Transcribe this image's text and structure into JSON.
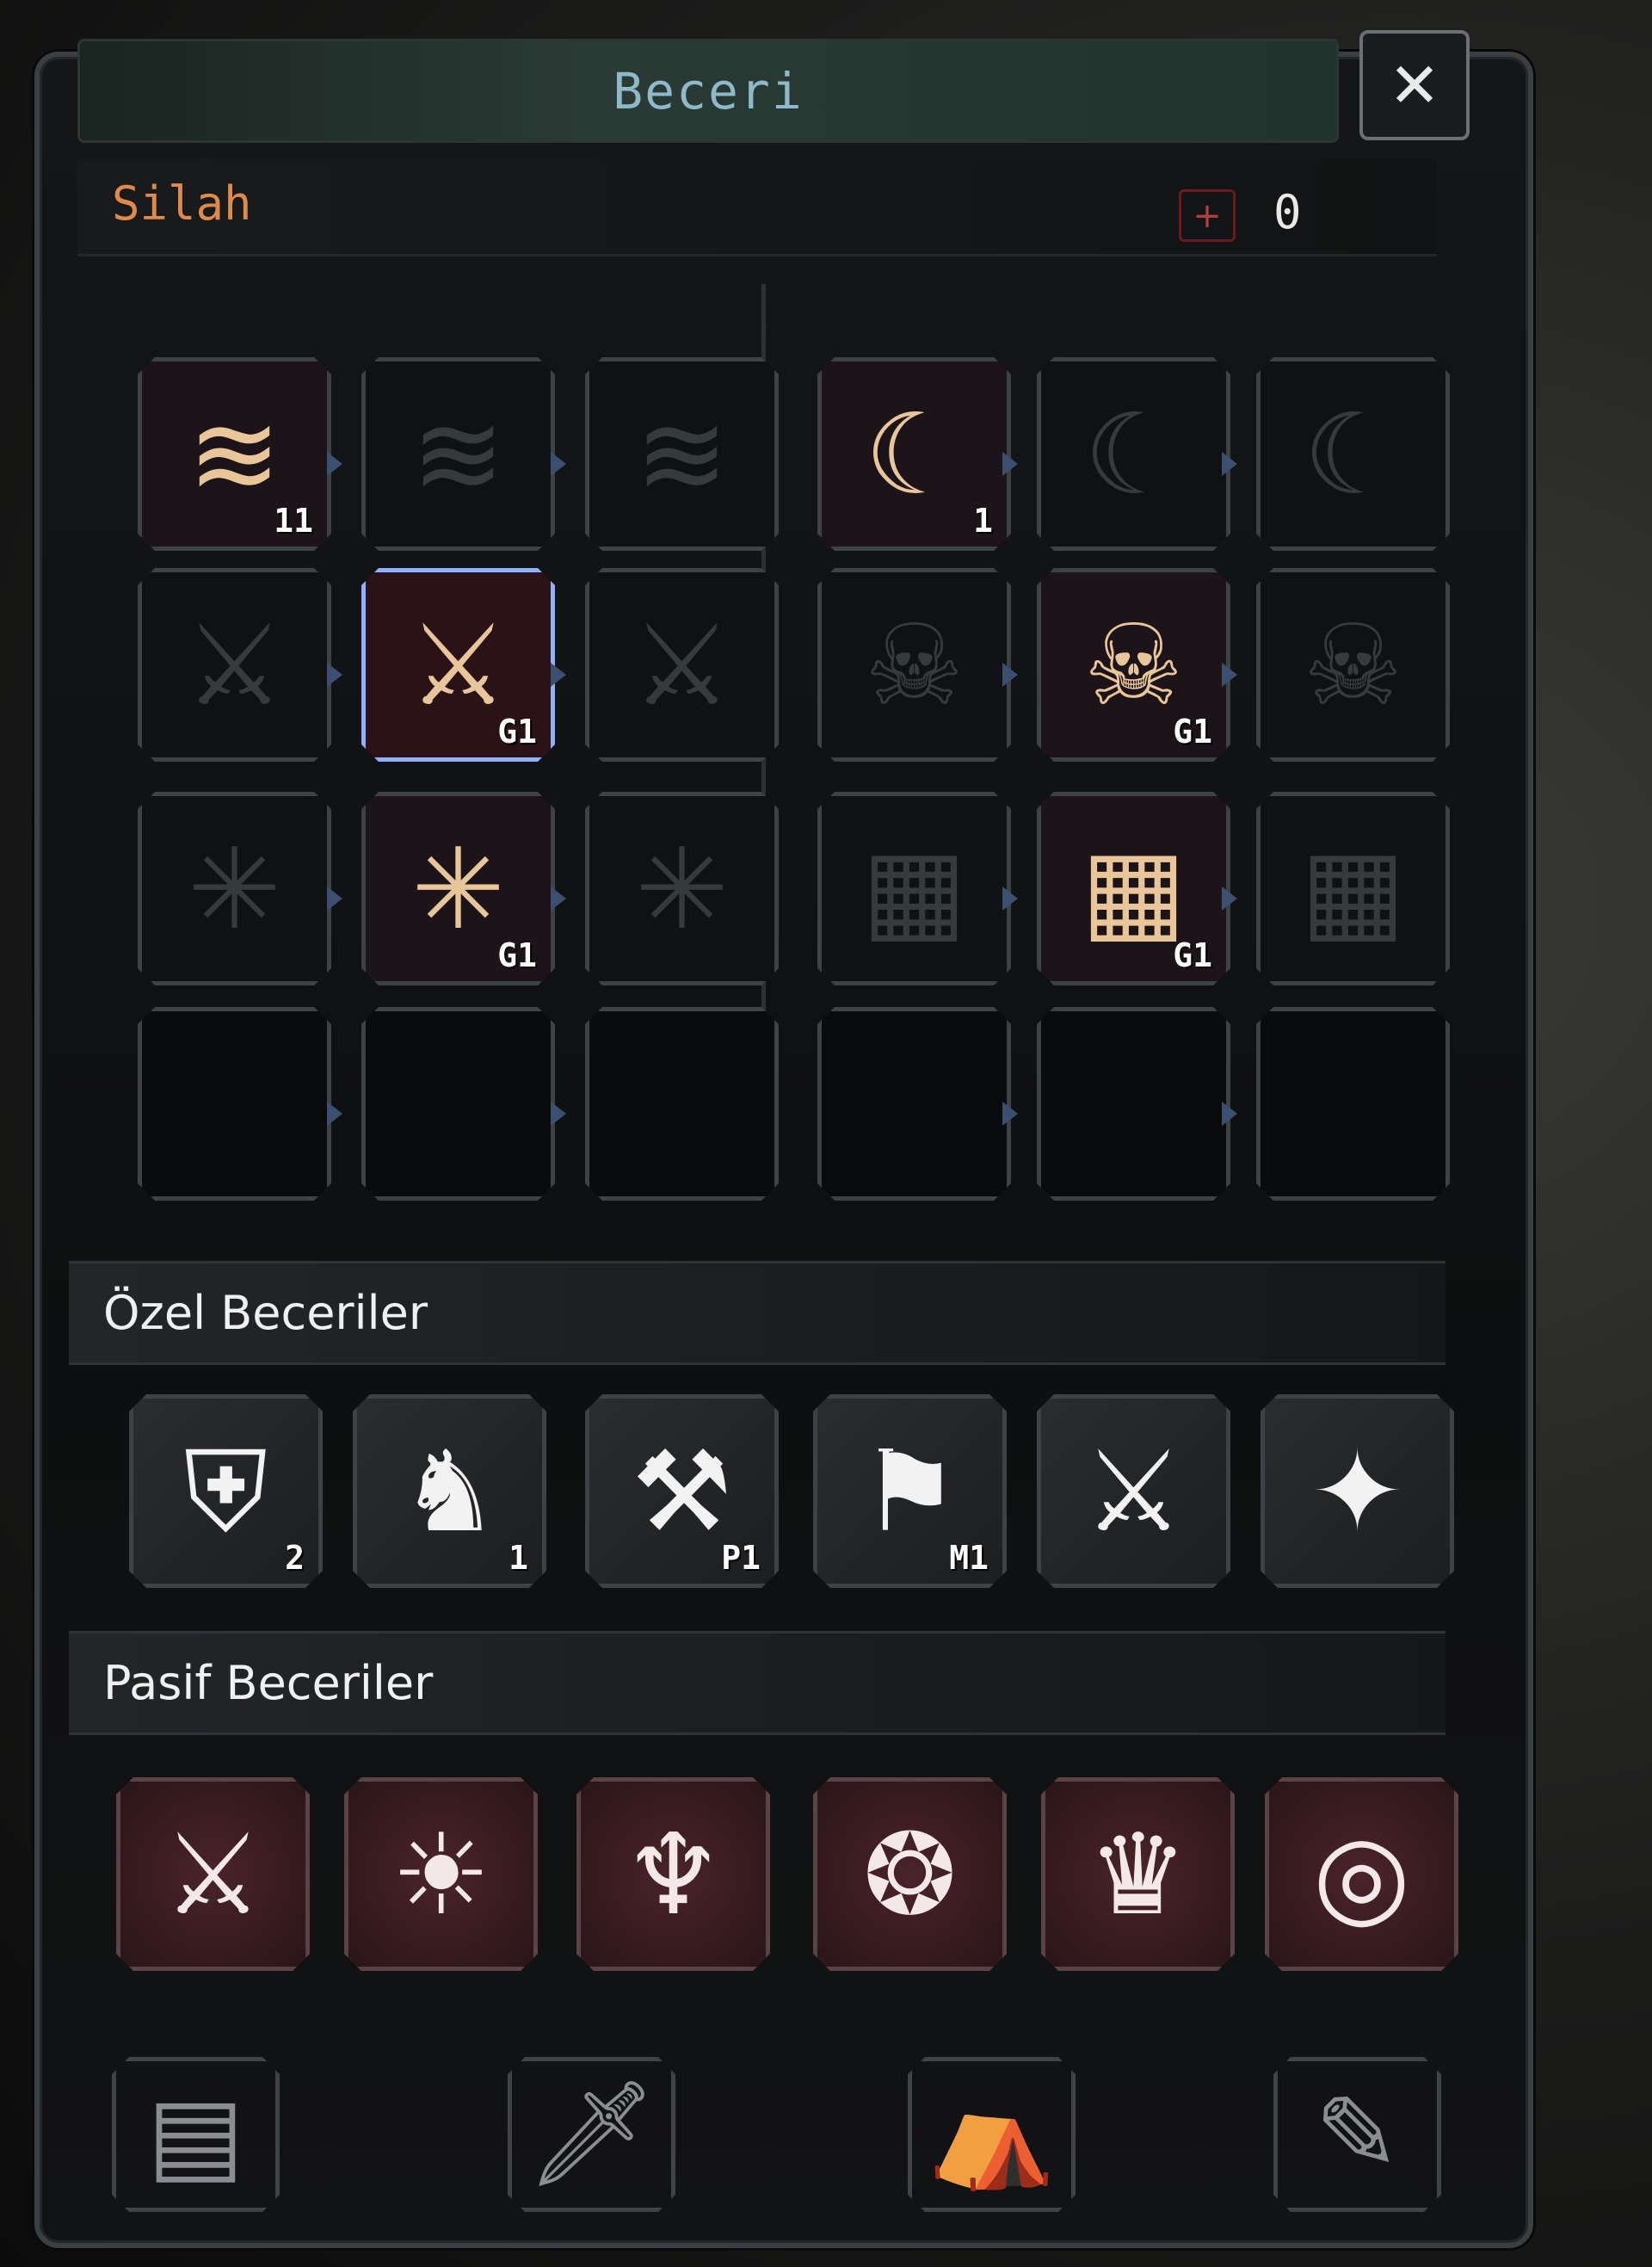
{
  "window": {
    "title": "Beceri",
    "close_label": "✕"
  },
  "weapon": {
    "label": "Silah",
    "points_plus": "+",
    "points": "0"
  },
  "weapon_grid": [
    {
      "icon": "wind-slash-icon",
      "glyph": "≋",
      "state": "lit",
      "level": "11"
    },
    {
      "icon": "wind-slash-icon",
      "glyph": "≋",
      "state": "dim",
      "level": ""
    },
    {
      "icon": "wind-slash-icon",
      "glyph": "≋",
      "state": "dim",
      "level": ""
    },
    {
      "icon": "crescent-blade-icon",
      "glyph": "☾",
      "state": "lit",
      "level": "1"
    },
    {
      "icon": "crescent-blade-icon",
      "glyph": "☾",
      "state": "dim",
      "level": ""
    },
    {
      "icon": "crescent-blade-icon",
      "glyph": "☾",
      "state": "dim",
      "level": ""
    },
    {
      "icon": "sword-icon",
      "glyph": "⚔",
      "state": "dim",
      "level": ""
    },
    {
      "icon": "sword-icon",
      "glyph": "⚔",
      "state": "selected",
      "level": "G1"
    },
    {
      "icon": "sword-icon",
      "glyph": "⚔",
      "state": "dim",
      "level": ""
    },
    {
      "icon": "skull-icon",
      "glyph": "☠",
      "state": "dim",
      "level": ""
    },
    {
      "icon": "skull-icon",
      "glyph": "☠",
      "state": "lit",
      "level": "G1"
    },
    {
      "icon": "skull-icon",
      "glyph": "☠",
      "state": "dim",
      "level": ""
    },
    {
      "icon": "burst-icon",
      "glyph": "✳",
      "state": "dim",
      "level": ""
    },
    {
      "icon": "burst-icon",
      "glyph": "✳",
      "state": "lit",
      "level": "G1"
    },
    {
      "icon": "burst-icon",
      "glyph": "✳",
      "state": "dim",
      "level": ""
    },
    {
      "icon": "rune-icon",
      "glyph": "▦",
      "state": "dim",
      "level": ""
    },
    {
      "icon": "rune-icon",
      "glyph": "▦",
      "state": "lit",
      "level": "G1"
    },
    {
      "icon": "rune-icon",
      "glyph": "▦",
      "state": "dim",
      "level": ""
    },
    {
      "icon": "empty-slot",
      "glyph": "",
      "state": "empty",
      "level": ""
    },
    {
      "icon": "empty-slot",
      "glyph": "",
      "state": "empty",
      "level": ""
    },
    {
      "icon": "empty-slot",
      "glyph": "",
      "state": "empty",
      "level": ""
    },
    {
      "icon": "empty-slot",
      "glyph": "",
      "state": "empty",
      "level": ""
    },
    {
      "icon": "empty-slot",
      "glyph": "",
      "state": "empty",
      "level": ""
    },
    {
      "icon": "empty-slot",
      "glyph": "",
      "state": "empty",
      "level": ""
    }
  ],
  "special": {
    "label": "Özel Beceriler",
    "items": [
      {
        "icon": "sword-shield-icon",
        "glyph": "⛨",
        "level": "2"
      },
      {
        "icon": "horse-icon",
        "glyph": "♞",
        "level": "1"
      },
      {
        "icon": "pickaxe-icon",
        "glyph": "⚒",
        "level": "P1"
      },
      {
        "icon": "flag-icon",
        "glyph": "⚑",
        "level": "M1"
      },
      {
        "icon": "axe-sword-icon",
        "glyph": "⚔",
        "level": ""
      },
      {
        "icon": "shuriken-icon",
        "glyph": "✦",
        "level": ""
      }
    ]
  },
  "passive": {
    "label": "Pasif Beceriler",
    "items": [
      {
        "icon": "crossed-blades-icon",
        "glyph": "⚔"
      },
      {
        "icon": "sun-gear-icon",
        "glyph": "☀"
      },
      {
        "icon": "dragon-icon",
        "glyph": "♆"
      },
      {
        "icon": "phoenix-icon",
        "glyph": "❂"
      },
      {
        "icon": "crown-icon",
        "glyph": "♛"
      },
      {
        "icon": "spiral-icon",
        "glyph": "◎"
      }
    ]
  },
  "tabs": [
    {
      "icon": "book-icon",
      "glyph": "▤"
    },
    {
      "icon": "sword-tab-icon",
      "glyph": "🗡"
    },
    {
      "icon": "tent-icon",
      "glyph": "⛺"
    },
    {
      "icon": "scroll-icon",
      "glyph": "✎"
    }
  ]
}
